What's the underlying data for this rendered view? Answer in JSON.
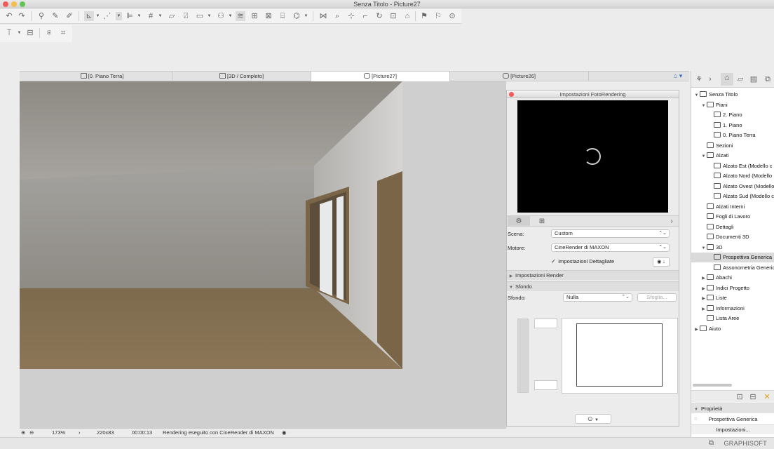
{
  "window": {
    "title": "Senza Titolo - Picture27"
  },
  "tabs": [
    {
      "label": "[0. Piano Terra]",
      "active": false
    },
    {
      "label": "[3D / Completo]",
      "active": false
    },
    {
      "label": "[Picture27]",
      "active": true
    },
    {
      "label": "[Picture26]",
      "active": false
    }
  ],
  "status": {
    "zoom": "173%",
    "size": "220x83",
    "time": "00:00:13",
    "message": "Rendering eseguito con CineRender di MAXON"
  },
  "palette": {
    "title": "Impostazioni FotoRendering",
    "scena_label": "Scena:",
    "scena_value": "Custom",
    "motore_label": "Motore:",
    "motore_value": "CineRender di MAXON",
    "detailed_label": "Impostazioni Dettagliate",
    "detailed_checked": true,
    "section_render": "Impostazioni Render",
    "section_sfondo": "Sfondo",
    "sfondo_label": "Sfondo:",
    "sfondo_value": "Nulla",
    "sfoglia_label": "Sfoglia..."
  },
  "navigator": {
    "items": [
      {
        "label": "Senza Titolo",
        "depth": 0,
        "tw": "▼",
        "selected": false
      },
      {
        "label": "Piani",
        "depth": 1,
        "tw": "▼",
        "selected": false
      },
      {
        "label": "2. Piano",
        "depth": 2,
        "tw": "",
        "selected": false
      },
      {
        "label": "1. Piano",
        "depth": 2,
        "tw": "",
        "selected": false
      },
      {
        "label": "0. Piano Terra",
        "depth": 2,
        "tw": "",
        "selected": false
      },
      {
        "label": "Sezioni",
        "depth": 1,
        "tw": "",
        "selected": false
      },
      {
        "label": "Alzati",
        "depth": 1,
        "tw": "▼",
        "selected": false
      },
      {
        "label": "Alzato Est (Modello c",
        "depth": 2,
        "tw": "",
        "selected": false
      },
      {
        "label": "Alzato Nord (Modello",
        "depth": 2,
        "tw": "",
        "selected": false
      },
      {
        "label": "Alzato Ovest (Modello",
        "depth": 2,
        "tw": "",
        "selected": false
      },
      {
        "label": "Alzato Sud (Modello c",
        "depth": 2,
        "tw": "",
        "selected": false
      },
      {
        "label": "Alzati Interni",
        "depth": 1,
        "tw": "",
        "selected": false
      },
      {
        "label": "Fogli di Lavoro",
        "depth": 1,
        "tw": "",
        "selected": false
      },
      {
        "label": "Dettagli",
        "depth": 1,
        "tw": "",
        "selected": false
      },
      {
        "label": "Documenti 3D",
        "depth": 1,
        "tw": "",
        "selected": false
      },
      {
        "label": "3D",
        "depth": 1,
        "tw": "▼",
        "selected": false
      },
      {
        "label": "Prospettiva Generica",
        "depth": 2,
        "tw": "",
        "selected": true
      },
      {
        "label": "Assonometria Generic",
        "depth": 2,
        "tw": "",
        "selected": false
      },
      {
        "label": "Abachi",
        "depth": 1,
        "tw": "▶",
        "selected": false
      },
      {
        "label": "Indici Progetto",
        "depth": 1,
        "tw": "▶",
        "selected": false
      },
      {
        "label": "Liste",
        "depth": 1,
        "tw": "▶",
        "selected": false
      },
      {
        "label": "Informazioni",
        "depth": 1,
        "tw": "▶",
        "selected": false
      },
      {
        "label": "Lista Aree",
        "depth": 1,
        "tw": "",
        "selected": false
      },
      {
        "label": "Aiuto",
        "depth": 0,
        "tw": "▶",
        "selected": false
      }
    ],
    "props_label": "Proprietà",
    "props_value": "Prospettiva Generica",
    "settings_button": "Impostazioni..."
  },
  "footer": {
    "brand": "GRAPHISOFT"
  },
  "colors": {
    "close": "#f15b5b",
    "minimize": "#f5bf4f",
    "maximize": "#61c454"
  }
}
